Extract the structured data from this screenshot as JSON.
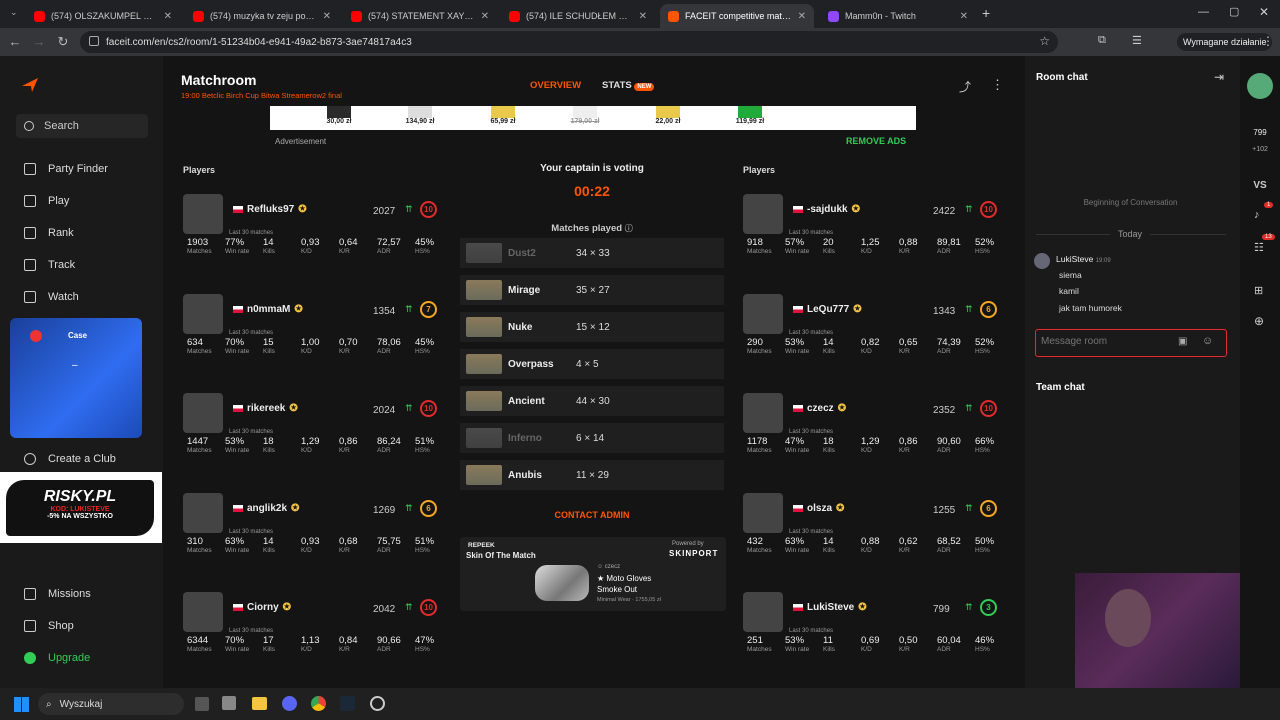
{
  "browser": {
    "tabs": [
      {
        "title": "(574) OLSZAKUMPEL VS BARY",
        "color": "#ff0000"
      },
      {
        "title": "(574) muzyka tv zeju pog - You",
        "color": "#ff0000"
      },
      {
        "title": "(574) STATEMENT XAYOO Zeju",
        "color": "#ff0000"
      },
      {
        "title": "(574) ILE SCHUDŁEM W 3 MIES",
        "color": "#ff0000"
      },
      {
        "title": "FACEIT competitive match - FAC",
        "color": "#ff5500"
      },
      {
        "title": "Mamm0n - Twitch",
        "color": "#9146ff"
      }
    ],
    "url": "faceit.com/en/cs2/room/1-51234b04-e941-49a2-b873-3ae74817a4c3",
    "action_label": "Wymagane działanie"
  },
  "sidebar": {
    "search": "Search",
    "items": [
      {
        "label": "Party Finder",
        "icon": "party-finder-icon"
      },
      {
        "label": "Play",
        "icon": "play-icon"
      },
      {
        "label": "Rank",
        "icon": "rank-icon"
      },
      {
        "label": "Track",
        "icon": "track-icon"
      },
      {
        "label": "Watch",
        "icon": "watch-icon"
      }
    ],
    "case_label": "Case",
    "create_club": "Create a Club",
    "promo_title": "RISKY.PL",
    "promo_code": "KOD: LUKISTEVE",
    "promo_sub": "-5% NA WSZYSTKO",
    "missions": "Missions",
    "shop": "Shop",
    "upgrade": "Upgrade"
  },
  "header": {
    "title": "Matchroom",
    "subtitle": "19:00 Betclic Birch Cup Bitwa Streamerow2 final",
    "tab_overview": "OVERVIEW",
    "tab_stats": "STATS",
    "new_badge": "NEW"
  },
  "ads": {
    "prices": [
      "30,00 zł",
      "134,90 zł",
      "65,99 zł",
      "179,00 zł",
      "22,00 zł",
      "119,99 zł"
    ],
    "advertisement": "Advertisement",
    "remove_ads": "REMOVE ADS"
  },
  "center": {
    "captain_text": "Your captain is voting",
    "timer": "00:22",
    "matches_played": "Matches played",
    "contact_admin": "CONTACT ADMIN",
    "maps": [
      {
        "name": "Dust2",
        "result": "34 × 33",
        "dim": true
      },
      {
        "name": "Mirage",
        "result": "35 × 27",
        "dim": false
      },
      {
        "name": "Nuke",
        "result": "15 × 12",
        "dim": false
      },
      {
        "name": "Overpass",
        "result": "4 × 5",
        "dim": false
      },
      {
        "name": "Ancient",
        "result": "44 × 30",
        "dim": false
      },
      {
        "name": "Inferno",
        "result": "6 × 14",
        "dim": true
      },
      {
        "name": "Anubis",
        "result": "11 × 29",
        "dim": false
      }
    ],
    "skin": {
      "sponsor": "REPEEK",
      "title": "Skin Of The Match",
      "powered": "Powered by",
      "brand": "SKINPORT",
      "owner": "czecz",
      "item": "★ Moto Gloves",
      "item2": "Smoke Out",
      "price": "Minimal Wear · 1755,05 zł"
    }
  },
  "team_labels": {
    "left": "Players",
    "right": "Players"
  },
  "stat_labels": [
    "Matches",
    "Win rate",
    "Kills",
    "K/D",
    "K/R",
    "ADR",
    "HS%"
  ],
  "last30": "Last 30 matches",
  "team_left": [
    {
      "name": "Refluks97",
      "elo": "2027",
      "level": "10",
      "stats": [
        "1903",
        "77%",
        "14",
        "0,93",
        "0,64",
        "72,57",
        "45%"
      ]
    },
    {
      "name": "n0mmaM",
      "elo": "1354",
      "level": "7",
      "stats": [
        "634",
        "70%",
        "15",
        "1,00",
        "0,70",
        "78,06",
        "45%"
      ]
    },
    {
      "name": "rikereek",
      "elo": "2024",
      "level": "10",
      "stats": [
        "1447",
        "53%",
        "18",
        "1,29",
        "0,86",
        "86,24",
        "51%"
      ]
    },
    {
      "name": "anglik2k",
      "elo": "1269",
      "level": "6",
      "stats": [
        "310",
        "63%",
        "14",
        "0,93",
        "0,68",
        "75,75",
        "51%"
      ]
    },
    {
      "name": "Ciorny",
      "elo": "2042",
      "level": "10",
      "stats": [
        "6344",
        "70%",
        "17",
        "1,13",
        "0,84",
        "90,66",
        "47%"
      ]
    }
  ],
  "team_right": [
    {
      "name": "-sajdukk",
      "elo": "2422",
      "level": "10",
      "stats": [
        "918",
        "57%",
        "20",
        "1,25",
        "0,88",
        "89,81",
        "52%"
      ]
    },
    {
      "name": "LeQu777",
      "elo": "1343",
      "level": "6",
      "stats": [
        "290",
        "53%",
        "14",
        "0,82",
        "0,65",
        "74,39",
        "52%"
      ]
    },
    {
      "name": "czecz",
      "elo": "2352",
      "level": "10",
      "stats": [
        "1178",
        "47%",
        "18",
        "1,29",
        "0,86",
        "90,60",
        "66%"
      ]
    },
    {
      "name": "olsza",
      "elo": "1255",
      "level": "6",
      "stats": [
        "432",
        "63%",
        "14",
        "0,88",
        "0,62",
        "68,52",
        "50%"
      ]
    },
    {
      "name": "LukiSteve",
      "elo": "799",
      "level": "3",
      "stats": [
        "251",
        "53%",
        "11",
        "0,69",
        "0,50",
        "60,04",
        "46%"
      ]
    }
  ],
  "chat": {
    "title": "Room chat",
    "beginning": "Beginning of Conversation",
    "today": "Today",
    "author": "LukiSteve",
    "time": "19:09",
    "messages": [
      "siema",
      "kamil",
      "jak tam humorek"
    ],
    "placeholder": "Message room",
    "team_chat": "Team chat"
  },
  "rail": {
    "elo": "799",
    "delta": "+102",
    "vs": "VS",
    "notif": "1",
    "friends": "13"
  },
  "taskbar": {
    "search": "Wyszukaj"
  },
  "colors": {
    "accent": "#ff5500",
    "level_red": "#e52a2a",
    "level_yellow": "#f5a623",
    "level_green": "#33cc55"
  }
}
